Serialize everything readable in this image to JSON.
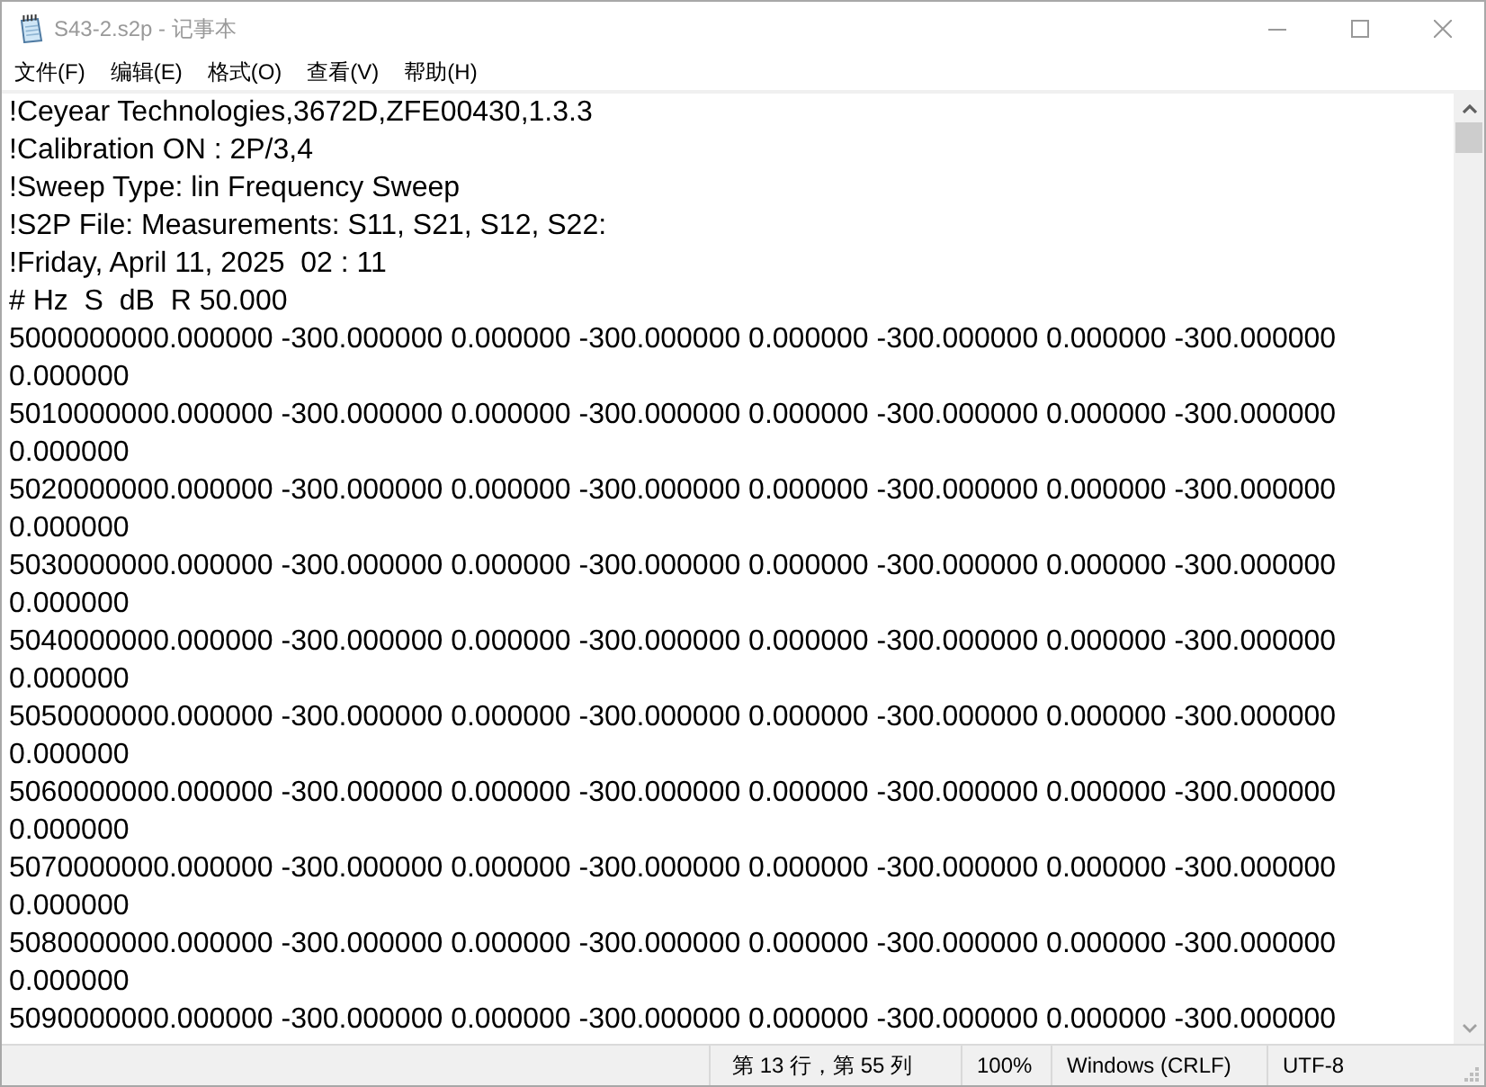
{
  "window": {
    "title": "S43-2.s2p - 记事本"
  },
  "menu": [
    "文件(F)",
    "编辑(E)",
    "格式(O)",
    "查看(V)",
    "帮助(H)"
  ],
  "document": {
    "lines": [
      "!Ceyear Technologies,3672D,ZFE00430,1.3.3",
      "!Calibration ON : 2P/3,4",
      "!Sweep Type: lin Frequency Sweep",
      "!S2P File: Measurements: S11, S21, S12, S22:",
      "!Friday, April 11, 2025  02 : 11",
      "# Hz  S  dB  R 50.000",
      "5000000000.000000 -300.000000 0.000000 -300.000000 0.000000 -300.000000 0.000000 -300.000000 0.000000",
      "5010000000.000000 -300.000000 0.000000 -300.000000 0.000000 -300.000000 0.000000 -300.000000 0.000000",
      "5020000000.000000 -300.000000 0.000000 -300.000000 0.000000 -300.000000 0.000000 -300.000000 0.000000",
      "5030000000.000000 -300.000000 0.000000 -300.000000 0.000000 -300.000000 0.000000 -300.000000 0.000000",
      "5040000000.000000 -300.000000 0.000000 -300.000000 0.000000 -300.000000 0.000000 -300.000000 0.000000",
      "5050000000.000000 -300.000000 0.000000 -300.000000 0.000000 -300.000000 0.000000 -300.000000 0.000000",
      "5060000000.000000 -300.000000 0.000000 -300.000000 0.000000 -300.000000 0.000000 -300.000000 0.000000",
      "5070000000.000000 -300.000000 0.000000 -300.000000 0.000000 -300.000000 0.000000 -300.000000 0.000000",
      "5080000000.000000 -300.000000 0.000000 -300.000000 0.000000 -300.000000 0.000000 -300.000000 0.000000",
      "5090000000.000000 -300.000000 0.000000 -300.000000 0.000000 -300.000000 0.000000 -300.000000"
    ]
  },
  "status_bar": {
    "cursor_position": "第 13 行，第 55 列",
    "zoom": "100%",
    "line_ending": "Windows (CRLF)",
    "encoding": "UTF-8"
  }
}
